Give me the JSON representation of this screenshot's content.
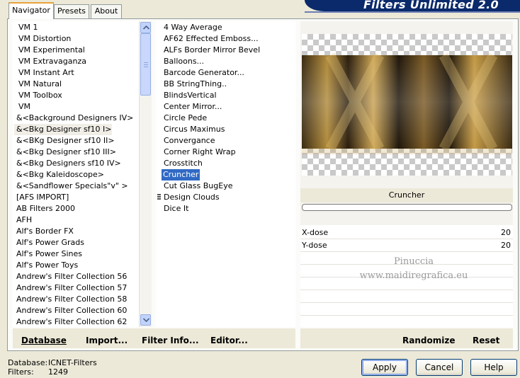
{
  "banner_title": "Filters Unlimited 2.0",
  "tabs": [
    {
      "label": "Navigator",
      "active": true
    },
    {
      "label": "Presets",
      "active": false
    },
    {
      "label": "About",
      "active": false
    }
  ],
  "categories": [
    "VM 1",
    "VM Distortion",
    "VM Experimental",
    "VM Extravaganza",
    "VM Instant Art",
    "VM Natural",
    "VM Toolbox",
    "VM",
    "&<Background Designers IV>",
    "&<Bkg Designer sf10 I>",
    "&<BKg Designer sf10 II>",
    "&<Bkg Designer sf10 III>",
    "&<Bkg Designers sf10 IV>",
    "&<Bkg Kaleidoscope>",
    "&<Sandflower Specials\"v\" >",
    "[AFS IMPORT]",
    "AB Filters 2000",
    "AFH",
    "Alf's Border FX",
    "Alf's Power Grads",
    "Alf's Power Sines",
    "Alf's Power Toys",
    "Andrew's Filter Collection 56",
    "Andrew's Filter Collection 57",
    "Andrew's Filter Collection 58",
    "Andrew's Filter Collection 60",
    "Andrew's Filter Collection 62"
  ],
  "selected_category": "&<Bkg Designer sf10 I>",
  "filters": [
    "4 Way Average",
    "AF62 Effected Emboss...",
    "ALFs Border Mirror Bevel",
    "Balloons...",
    "Barcode Generator...",
    "BB StringThing..",
    "BlindsVertical",
    "Center Mirror...",
    "Circle Pede",
    "Circus Maximus",
    "Convergance",
    "Corner Right Wrap",
    "Crosstitch",
    "Cruncher",
    "Cut Glass  BugEye",
    "Design Clouds",
    "Dice It"
  ],
  "selected_filter": "Cruncher",
  "preview_filter_name": "Cruncher",
  "params": [
    {
      "label": "X-dose",
      "value": "20"
    },
    {
      "label": "Y-dose",
      "value": "20"
    }
  ],
  "watermark": {
    "line1": "Pinuccia",
    "line2": "www.maidiregrafica.eu"
  },
  "left_buttons": {
    "database": "Database",
    "import": "Import...",
    "filter_info": "Filter Info...",
    "editor": "Editor..."
  },
  "right_buttons": {
    "randomize": "Randomize",
    "reset": "Reset"
  },
  "status": {
    "database_label": "Database:",
    "database_value": "ICNET-Filters",
    "filters_label": "Filters:",
    "filters_value": "1249"
  },
  "dialog_buttons": {
    "apply": "Apply",
    "cancel": "Cancel",
    "help": "Help"
  },
  "colors": {
    "banner": "#0a2a6b",
    "selection": "#316ac5",
    "tab_accent": "#e8a33d",
    "background": "#ece9d8"
  }
}
